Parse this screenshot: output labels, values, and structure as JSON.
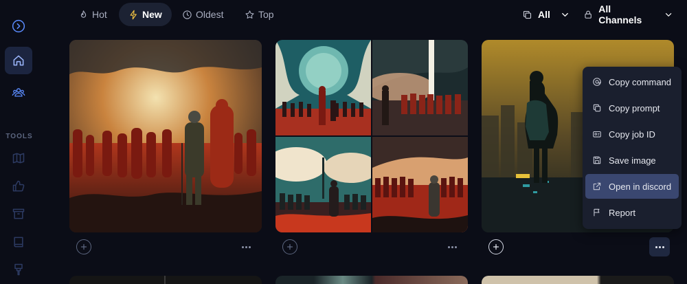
{
  "sidebar": {
    "items": [
      {
        "name": "toggle",
        "icon": "chevron-right-circle-icon"
      },
      {
        "name": "home",
        "icon": "home-icon"
      },
      {
        "name": "community",
        "icon": "users-icon"
      }
    ],
    "tools_label": "TOOLS",
    "tool_items": [
      {
        "icon": "map-icon"
      },
      {
        "icon": "thumbs-up-icon"
      },
      {
        "icon": "archive-icon"
      },
      {
        "icon": "book-icon"
      },
      {
        "icon": "brush-icon"
      }
    ]
  },
  "sort_tabs": [
    {
      "label": "Hot",
      "icon": "flame-icon",
      "active": false
    },
    {
      "label": "New",
      "icon": "bolt-icon",
      "active": true
    },
    {
      "label": "Oldest",
      "icon": "clock-icon",
      "active": false
    },
    {
      "label": "Top",
      "icon": "star-icon",
      "active": false
    }
  ],
  "filters": {
    "type": {
      "label": "All",
      "icon": "copy-icon"
    },
    "channel": {
      "label": "All Channels",
      "icon": "lock-icon"
    }
  },
  "context_menu": {
    "items": [
      {
        "label": "Copy command",
        "icon": "at-icon"
      },
      {
        "label": "Copy prompt",
        "icon": "copy-icon"
      },
      {
        "label": "Copy job ID",
        "icon": "id-icon"
      },
      {
        "label": "Save image",
        "icon": "save-icon"
      },
      {
        "label": "Open in discord",
        "icon": "external-link-icon",
        "highlighted": true
      },
      {
        "label": "Report",
        "icon": "flag-icon"
      }
    ]
  },
  "colors": {
    "background": "#0b0d17",
    "active_tab": "#1c2233",
    "menu_bg": "#1a1f2e",
    "menu_highlight": "#3a4770",
    "accent_bolt": "#f5c542"
  }
}
